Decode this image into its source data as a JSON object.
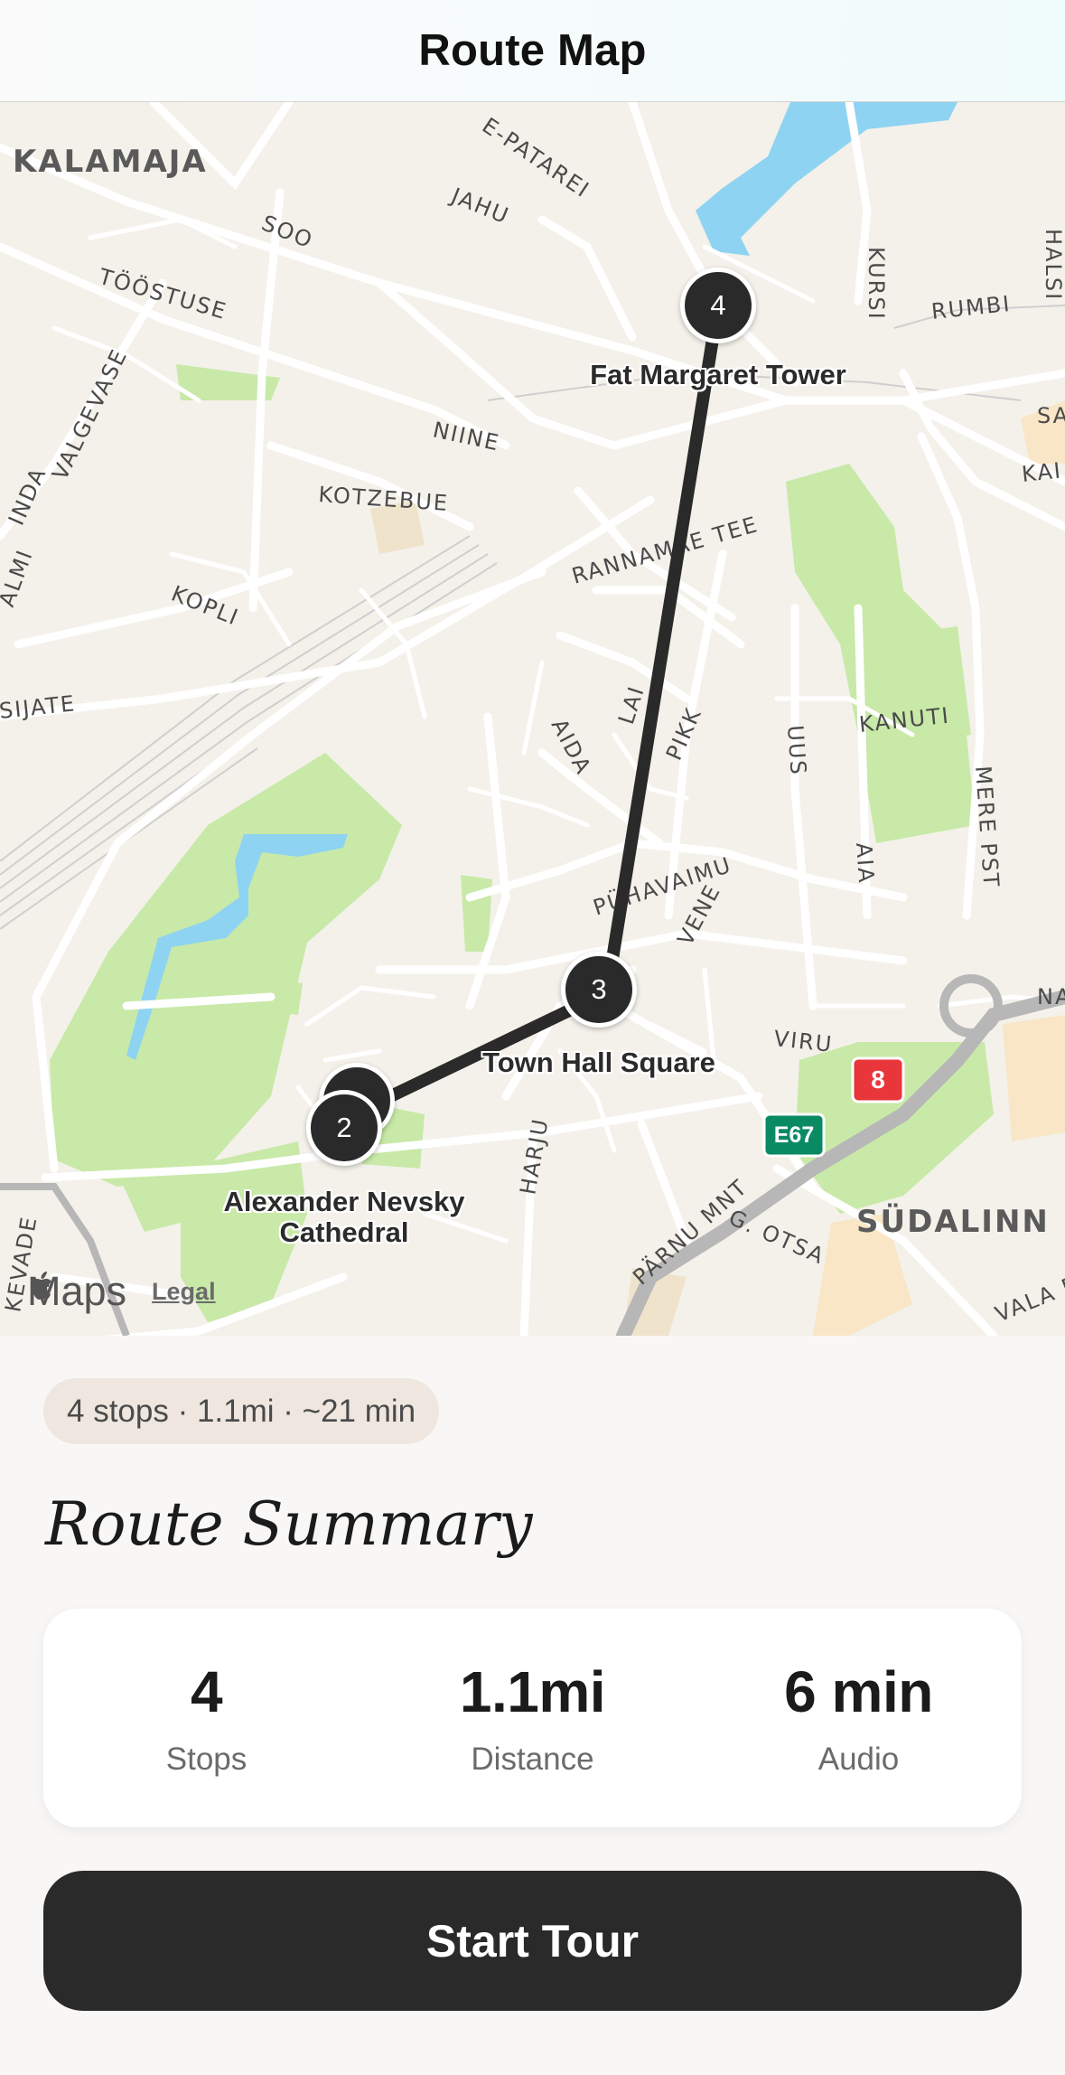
{
  "header": {
    "title": "Route Map"
  },
  "map": {
    "districts": [
      "KALAMAJA",
      "SÜDALINN"
    ],
    "streets": [
      "SOO",
      "JAHU",
      "TÖÖSTUSE",
      "VALGEVASE",
      "NIINE",
      "KOTZEBUE",
      "KOPLI",
      "RANNAMÄE TEE",
      "LAI",
      "PIKK",
      "AIDA",
      "UUS",
      "KANUTI",
      "MERE PST",
      "AIA",
      "PÜHAVAIMU",
      "VENE",
      "VIRU",
      "HARJU",
      "PÄRNU MNT",
      "G. OTSA",
      "KURSI",
      "RUMBI",
      "SIJATE",
      "KEVADE",
      "E-PATAREI",
      "HALSI",
      "SA",
      "KAI",
      "INDA",
      "ALMI",
      "NA",
      "VALA P"
    ],
    "stops": [
      {
        "number": "4",
        "name": "Fat Margaret Tower"
      },
      {
        "number": "3",
        "name": "Town Hall Square"
      },
      {
        "number": "2",
        "name": "Alexander Nevsky Cathedral"
      }
    ],
    "road_shields": [
      "E67",
      "8"
    ],
    "brand": "Maps",
    "legal": "Legal"
  },
  "summary_chip": "4 stops · 1.1mi · ~21 min",
  "section_title": "Route Summary",
  "stats": [
    {
      "value": "4",
      "label": "Stops"
    },
    {
      "value": "1.1mi",
      "label": "Distance"
    },
    {
      "value": "6 min",
      "label": "Audio"
    }
  ],
  "start_button": "Start Tour",
  "colors": {
    "accent": "#2a2a2a",
    "park": "#c8e9a8",
    "water": "#8ed3f2",
    "map_bg": "#f4f1ea"
  }
}
